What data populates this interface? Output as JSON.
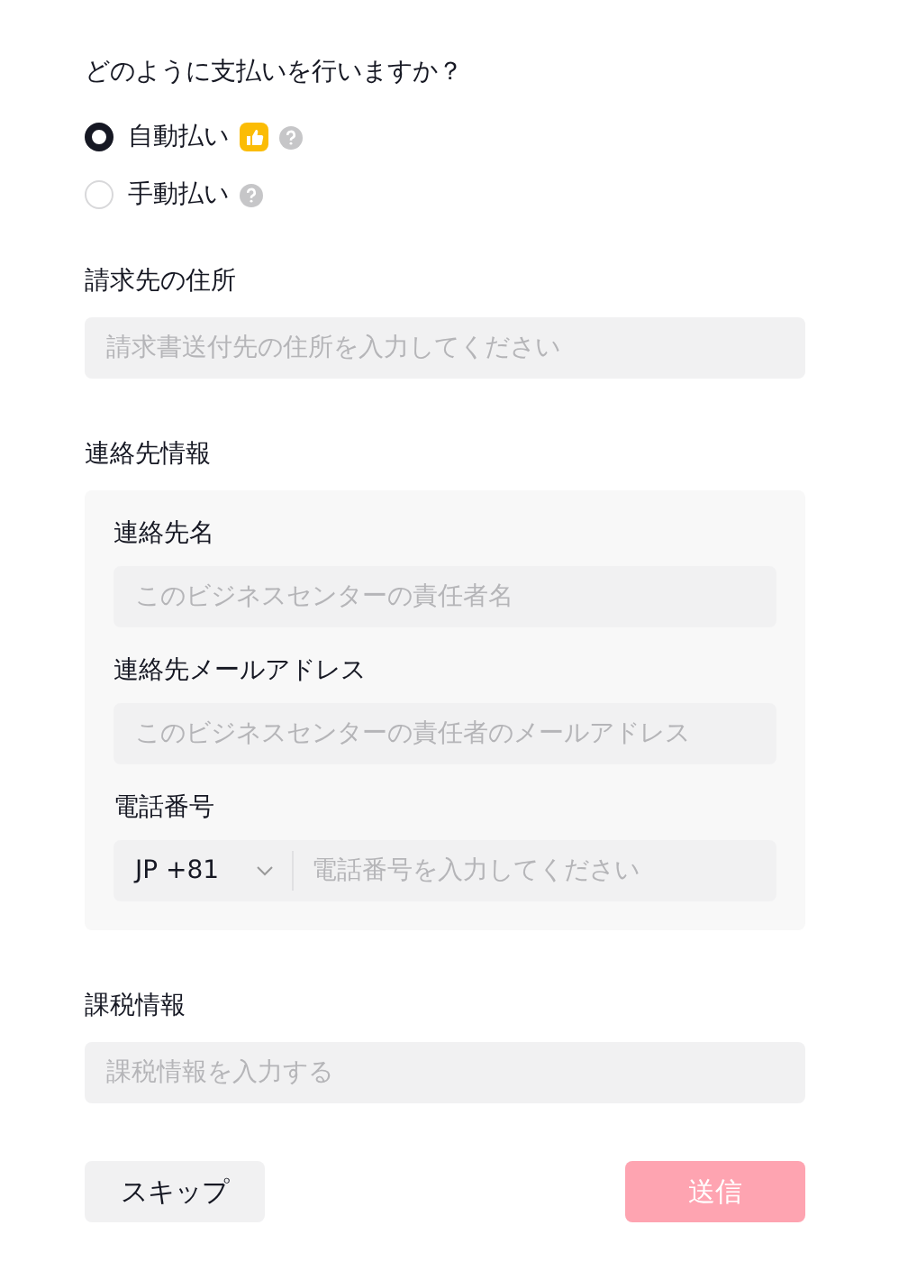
{
  "question": "どのように支払いを行いますか？",
  "payment_options": [
    {
      "label": "自動払い",
      "selected": true,
      "recommended": true
    },
    {
      "label": "手動払い",
      "selected": false,
      "recommended": false
    }
  ],
  "billing_address": {
    "label": "請求先の住所",
    "placeholder": "請求書送付先の住所を入力してください"
  },
  "contact": {
    "label": "連絡先情報",
    "fields": [
      {
        "kind": "text",
        "label": "連絡先名",
        "placeholder": "このビジネスセンターの責任者名"
      },
      {
        "kind": "text",
        "label": "連絡先メールアドレス",
        "placeholder": "このビジネスセンターの責任者のメールアドレス"
      },
      {
        "kind": "phone",
        "label": "電話番号",
        "country_code": "JP +81",
        "placeholder": "電話番号を入力してください"
      }
    ]
  },
  "tax": {
    "label": "課税情報",
    "placeholder": "課税情報を入力する"
  },
  "buttons": {
    "skip": {
      "label": "スキップ"
    },
    "submit": {
      "label": "送信",
      "disabled": true
    }
  }
}
